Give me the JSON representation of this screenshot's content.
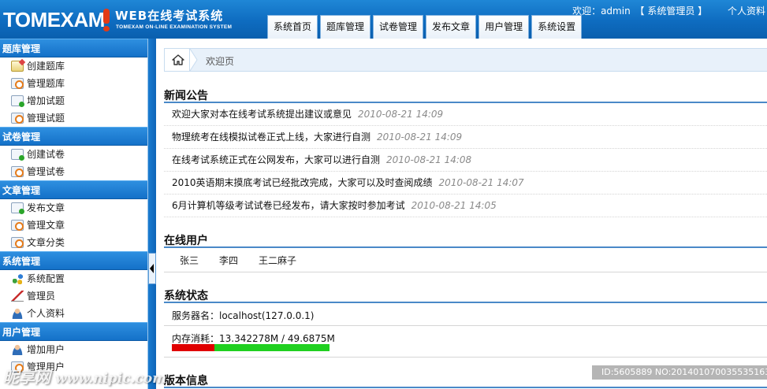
{
  "header": {
    "logo_text": "TOMEXAM",
    "logo_title": "WEB在线考试系统",
    "logo_subtitle": "TOMEXAM ON-LINE EXAMINATION SYSTEM",
    "tabs": [
      {
        "label": "系统首页"
      },
      {
        "label": "题库管理"
      },
      {
        "label": "试卷管理"
      },
      {
        "label": "发布文章"
      },
      {
        "label": "用户管理"
      },
      {
        "label": "系统设置"
      }
    ],
    "welcome": "欢迎：admin",
    "role": "【 系统管理员 】",
    "profile_link": "个人资料"
  },
  "sidebar": {
    "groups": [
      {
        "title": "题库管理",
        "items": [
          {
            "label": "创建题库",
            "icon": "edit-icon"
          },
          {
            "label": "管理题库",
            "icon": "gear-icon"
          },
          {
            "label": "增加试题",
            "icon": "add-icon"
          },
          {
            "label": "管理试题",
            "icon": "gear-icon"
          }
        ]
      },
      {
        "title": "试卷管理",
        "items": [
          {
            "label": "创建试卷",
            "icon": "add-icon"
          },
          {
            "label": "管理试卷",
            "icon": "gear-icon"
          }
        ]
      },
      {
        "title": "文章管理",
        "items": [
          {
            "label": "发布文章",
            "icon": "add-icon"
          },
          {
            "label": "管理文章",
            "icon": "gear-icon"
          },
          {
            "label": "文章分类",
            "icon": "gear-icon"
          }
        ]
      },
      {
        "title": "系统管理",
        "items": [
          {
            "label": "系统配置",
            "icon": "network-icon"
          },
          {
            "label": "管理员",
            "icon": "chart-icon"
          },
          {
            "label": "个人资料",
            "icon": "user-icon"
          }
        ]
      },
      {
        "title": "用户管理",
        "items": [
          {
            "label": "增加用户",
            "icon": "user-icon"
          },
          {
            "label": "管理用户",
            "icon": "gear-icon"
          }
        ]
      }
    ]
  },
  "breadcrumb": {
    "current": "欢迎页"
  },
  "news": {
    "title": "新闻公告",
    "items": [
      {
        "title": "欢迎大家对本在线考试系统提出建议或意见",
        "date": "2010-08-21 14:09"
      },
      {
        "title": "物理统考在线模拟试卷正式上线，大家进行自测",
        "date": "2010-08-21 14:09"
      },
      {
        "title": "在线考试系统正式在公网发布，大家可以进行自测",
        "date": "2010-08-21 14:08"
      },
      {
        "title": "2010英语期末摸底考试已经批改完成，大家可以及时查阅成绩",
        "date": "2010-08-21 14:07"
      },
      {
        "title": "6月计算机等级考试试卷已经发布，请大家按时参加考试",
        "date": "2010-08-21 14:05"
      }
    ]
  },
  "online": {
    "title": "在线用户",
    "users": [
      "张三",
      "李四",
      "王二麻子"
    ]
  },
  "status": {
    "title": "系统状态",
    "server_label": "服务器名：localhost(127.0.0.1)",
    "memory_label": "内存消耗：13.342278M / 49.6875M",
    "memory_used_fraction": 0.2686
  },
  "version": {
    "title": "版本信息"
  },
  "watermark": {
    "left_text": "昵享网",
    "left_url": "www.nipic.com",
    "right_text": "ID:5605889 NO:20140107003553516381"
  }
}
